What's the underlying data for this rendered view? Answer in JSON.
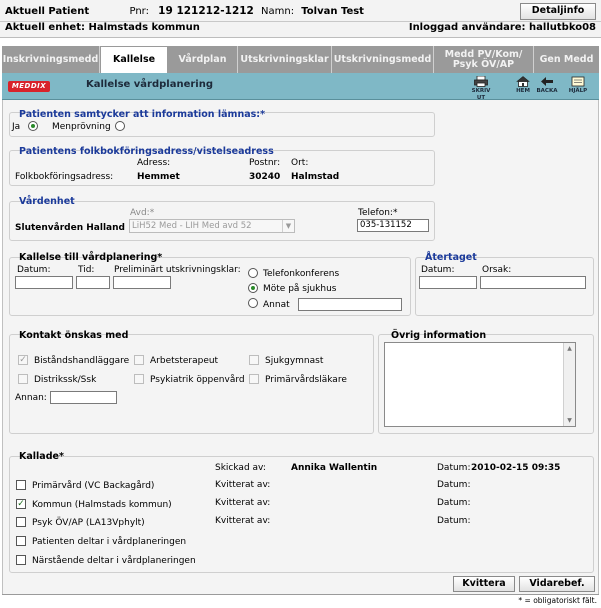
{
  "patient": {
    "label_current": "Aktuell Patient",
    "pnr_label": "Pnr:",
    "pnr": "19 121212-1212",
    "name_label": "Namn:",
    "name": "Tolvan Test",
    "unit_line": "Aktuell enhet: Halmstads kommun",
    "logged_in": "Inloggad användare: hallutbko08",
    "detail_button": "Detaljinfo"
  },
  "tabs": [
    {
      "label": "Inskrivningsmedd",
      "active": false
    },
    {
      "label": "Kallelse",
      "active": true
    },
    {
      "label": "Vårdplan",
      "active": false
    },
    {
      "label": "Utskrivningsklar",
      "active": false
    },
    {
      "label": "Utskrivningsmedd",
      "active": false
    },
    {
      "label": "Medd PV/Kom/\nPsyk ÖV/AP",
      "active": false
    },
    {
      "label": "Gen Medd",
      "active": false
    }
  ],
  "bar": {
    "logo": "MEDDIX",
    "title": "Kallelse vårdplanering",
    "tools": [
      {
        "label": "SKRIV UT",
        "icon": "printer-icon"
      },
      {
        "label": "HEM",
        "icon": "home-icon"
      },
      {
        "label": "BACKA",
        "icon": "back-icon"
      },
      {
        "label": "HJÄLP",
        "icon": "help-icon"
      }
    ],
    "bg_color": "#7fb8c6"
  },
  "consent": {
    "title": "Patienten samtycker att information lämnas:*",
    "yes_label": "Ja",
    "yes_checked": true,
    "menprovning_label": "Menprövning",
    "menprovning_checked": false
  },
  "address": {
    "title": "Patientens folkbokföringsadress/vistelseadress",
    "col_adress": "Adress:",
    "col_postnr": "Postnr:",
    "col_ort": "Ort:",
    "row_label": "Folkbokföringsadress:",
    "adress": "Hemmet",
    "postnr": "30240",
    "ort": "Halmstad"
  },
  "vardenhet": {
    "title": "Vårdenhet",
    "name": "Slutenvården Halland",
    "avd_label": "Avd:*",
    "avd_value": "LiH52 Med - LIH Med avd 52",
    "telefon_label": "Telefon:*",
    "telefon_value": "035-131152"
  },
  "kallelse": {
    "title": "Kallelse till vårdplanering*",
    "datum_label": "Datum:",
    "tid_label": "Tid:",
    "prel_label": "Preliminärt utskrivningsklar:",
    "datum_value": "",
    "tid_value": "",
    "prel_value": "",
    "options": [
      {
        "label": "Telefonkonferens",
        "checked": false
      },
      {
        "label": "Möte på sjukhus",
        "checked": true
      },
      {
        "label": "Annat",
        "checked": false
      }
    ],
    "annat_value": ""
  },
  "atertaget": {
    "title": "Återtaget",
    "datum_label": "Datum:",
    "orsak_label": "Orsak:",
    "datum_value": "",
    "orsak_value": ""
  },
  "kontakt": {
    "title": "Kontakt önskas med",
    "items": [
      {
        "label": "Biståndshandläggare",
        "checked": true
      },
      {
        "label": "Arbetsterapeut",
        "checked": false
      },
      {
        "label": "Sjukgymnast",
        "checked": false
      },
      {
        "label": "Distrikssk/Ssk",
        "checked": false
      },
      {
        "label": "Psykiatrik öppenvård",
        "checked": false
      },
      {
        "label": "Primärvårdsläkare",
        "checked": false
      }
    ],
    "annan_label": "Annan:",
    "annan_value": ""
  },
  "ovrig": {
    "title": "Övrig information",
    "value": ""
  },
  "kallade": {
    "title": "Kallade*",
    "skickad_label": "Skickad av:",
    "skickad_value": "Annika Wallentin",
    "datum_label": "Datum:",
    "datum_value": "2010-02-15 09:35",
    "rows": [
      {
        "label": "Primärvård (VC Backagård)",
        "checked": false,
        "kvitterat_label": "Kvitterat av:",
        "datum_label": "Datum:"
      },
      {
        "label": "Kommun (Halmstads kommun)",
        "checked": true,
        "kvitterat_label": "Kvitterat av:",
        "datum_label": "Datum:"
      },
      {
        "label": "Psyk ÖV/AP (LA13Vphylt)",
        "checked": false,
        "kvitterat_label": "Kvitterat av:",
        "datum_label": "Datum:"
      },
      {
        "label": "Patienten deltar i vårdplaneringen",
        "checked": false
      },
      {
        "label": "Närstående deltar i vårdplaneringen",
        "checked": false
      }
    ]
  },
  "actions": {
    "kvittera": "Kvittera",
    "vidarebef": "Vidarebef."
  },
  "footnote": "* = obligatoriskt fält."
}
